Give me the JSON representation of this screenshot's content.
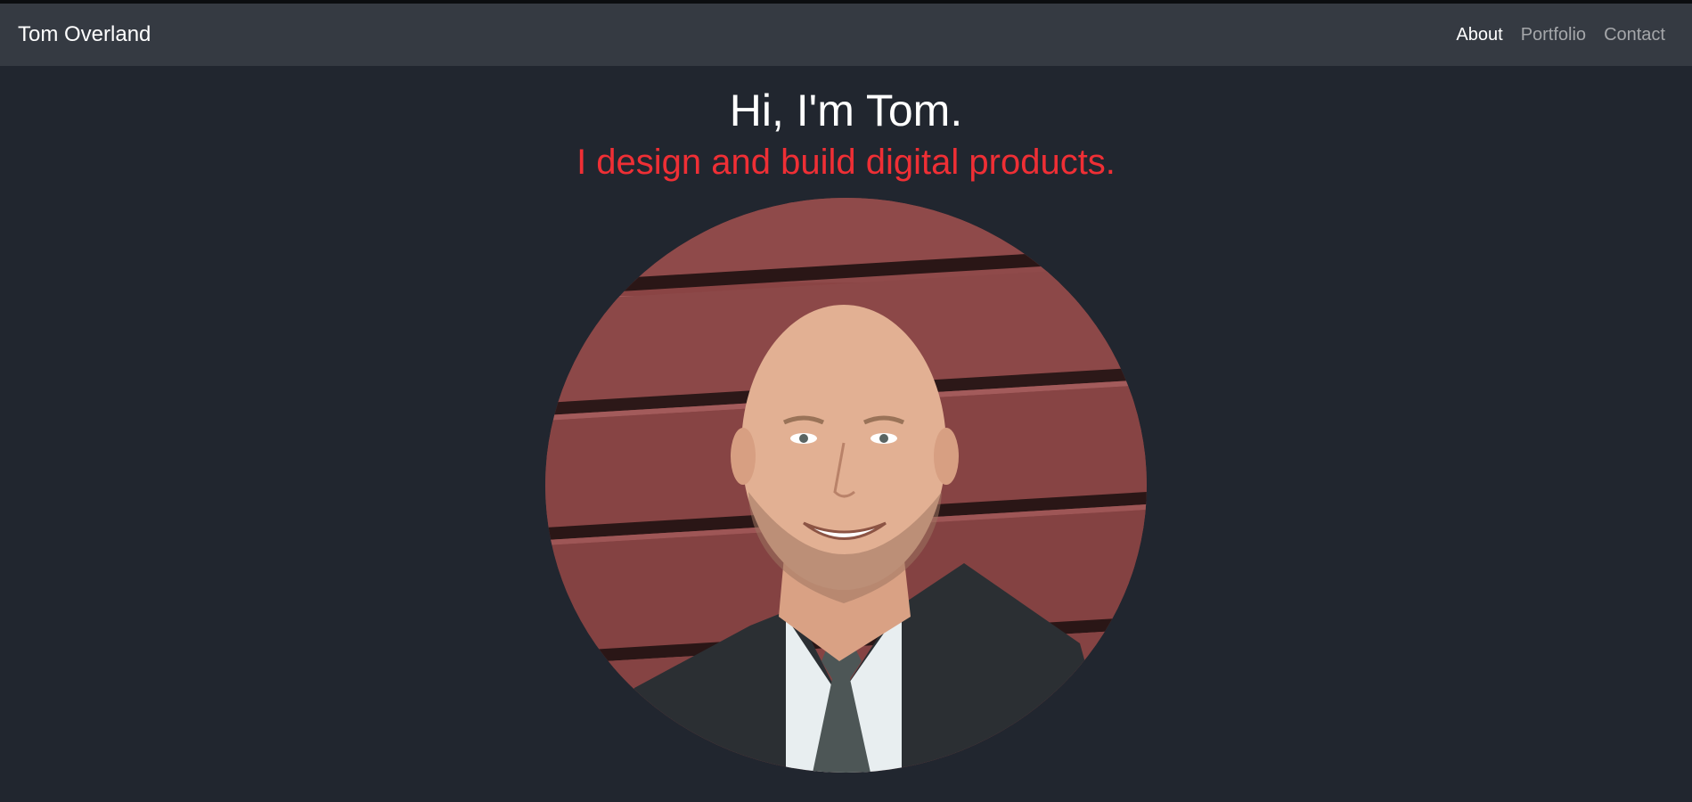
{
  "navbar": {
    "brand": "Tom Overland",
    "links": [
      {
        "label": "About",
        "active": true
      },
      {
        "label": "Portfolio",
        "active": false
      },
      {
        "label": "Contact",
        "active": false
      }
    ]
  },
  "hero": {
    "title": "Hi, I'm Tom.",
    "subtitle": "I design and build digital products."
  },
  "colors": {
    "page_background": "#21262f",
    "navbar_background": "#353a42",
    "accent": "#ef2f35"
  }
}
